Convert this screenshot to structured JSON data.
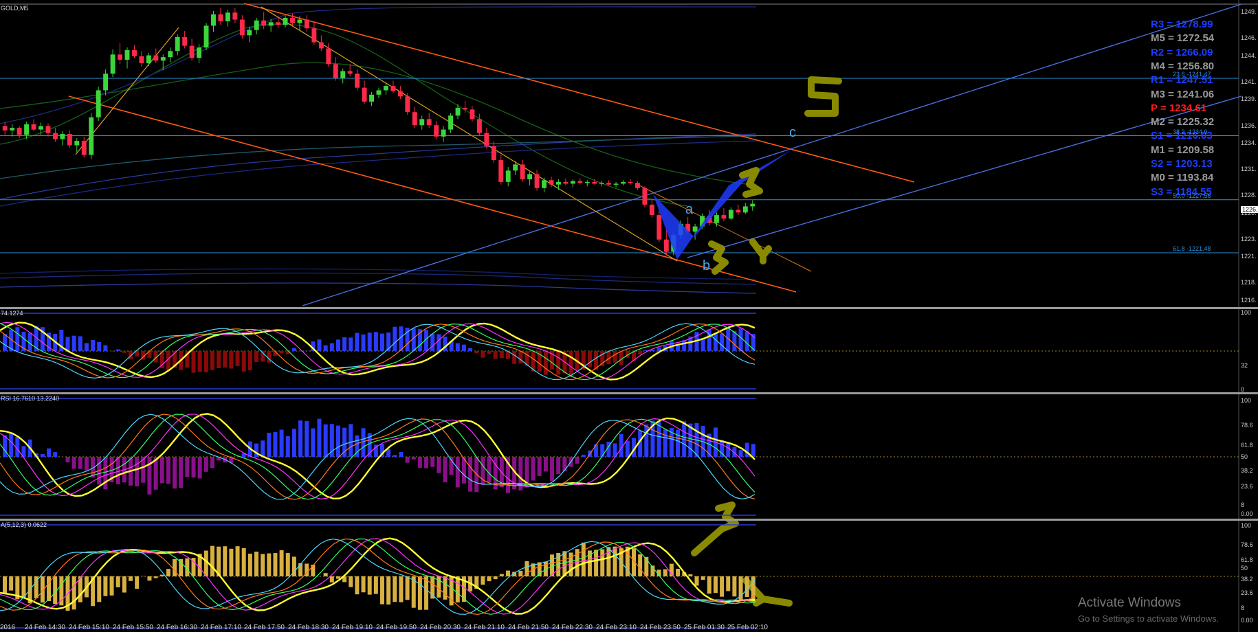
{
  "chart_data": [
    {
      "type": "candlestick",
      "title": "GOLD,M5",
      "y_ticks": [
        "1249.",
        "1246.",
        "1244.",
        "1241.",
        "1239.",
        "1236.",
        "1234.",
        "1231.",
        "1228.",
        "1226.",
        "1223.",
        "1221.",
        "1218.",
        "1216."
      ],
      "ylim": [
        1215.5,
        1249.5
      ],
      "current_price": "1226.",
      "ohlc": [
        [
          1236.0,
          1236.5,
          1235.0,
          1235.5
        ],
        [
          1235.5,
          1236.2,
          1234.8,
          1235.8
        ],
        [
          1235.8,
          1236.0,
          1234.6,
          1235.0
        ],
        [
          1235.0,
          1236.5,
          1234.5,
          1236.2
        ],
        [
          1236.2,
          1236.8,
          1235.4,
          1235.6
        ],
        [
          1235.6,
          1236.4,
          1235.0,
          1236.0
        ],
        [
          1236.0,
          1236.3,
          1234.8,
          1235.2
        ],
        [
          1235.2,
          1235.8,
          1234.2,
          1234.5
        ],
        [
          1234.5,
          1235.4,
          1233.8,
          1235.1
        ],
        [
          1235.1,
          1235.5,
          1233.5,
          1233.8
        ],
        [
          1233.8,
          1234.6,
          1233.0,
          1234.3
        ],
        [
          1234.3,
          1234.8,
          1232.4,
          1232.7
        ],
        [
          1232.7,
          1237.5,
          1232.2,
          1237.0
        ],
        [
          1237.0,
          1240.5,
          1236.6,
          1240.1
        ],
        [
          1240.1,
          1242.5,
          1239.5,
          1242.0
        ],
        [
          1242.0,
          1244.8,
          1241.6,
          1244.2
        ],
        [
          1244.2,
          1245.5,
          1243.1,
          1243.6
        ],
        [
          1243.6,
          1245.0,
          1242.6,
          1244.7
        ],
        [
          1244.7,
          1245.3,
          1243.8,
          1244.0
        ],
        [
          1244.0,
          1244.6,
          1242.8,
          1243.2
        ],
        [
          1243.2,
          1244.4,
          1242.9,
          1244.1
        ],
        [
          1244.1,
          1244.9,
          1243.2,
          1243.5
        ],
        [
          1243.5,
          1244.2,
          1242.4,
          1243.9
        ],
        [
          1243.9,
          1245.0,
          1243.3,
          1244.6
        ],
        [
          1244.6,
          1246.5,
          1244.1,
          1246.2
        ],
        [
          1246.2,
          1246.9,
          1244.9,
          1245.2
        ],
        [
          1245.2,
          1246.0,
          1243.5,
          1243.8
        ],
        [
          1243.8,
          1245.4,
          1243.2,
          1245.0
        ],
        [
          1245.0,
          1247.8,
          1244.7,
          1247.5
        ],
        [
          1247.5,
          1249.2,
          1246.8,
          1248.8
        ],
        [
          1248.8,
          1249.5,
          1247.6,
          1248.0
        ],
        [
          1248.0,
          1249.3,
          1247.4,
          1249.0
        ],
        [
          1249.0,
          1249.5,
          1247.8,
          1248.2
        ],
        [
          1248.2,
          1248.7,
          1246.0,
          1246.4
        ],
        [
          1246.4,
          1247.4,
          1245.6,
          1247.0
        ],
        [
          1247.0,
          1248.4,
          1246.5,
          1248.1
        ],
        [
          1248.1,
          1249.1,
          1247.1,
          1247.5
        ],
        [
          1247.5,
          1248.3,
          1246.8,
          1247.9
        ],
        [
          1247.9,
          1248.5,
          1247.2,
          1247.6
        ],
        [
          1247.6,
          1248.7,
          1247.3,
          1248.4
        ],
        [
          1248.4,
          1248.9,
          1247.5,
          1247.8
        ],
        [
          1247.8,
          1248.6,
          1247.0,
          1248.2
        ],
        [
          1248.2,
          1248.7,
          1246.8,
          1247.2
        ],
        [
          1247.2,
          1247.9,
          1245.3,
          1245.6
        ],
        [
          1245.6,
          1246.4,
          1244.6,
          1244.9
        ],
        [
          1244.9,
          1245.5,
          1242.8,
          1243.1
        ],
        [
          1243.1,
          1243.9,
          1241.2,
          1241.5
        ],
        [
          1241.5,
          1242.6,
          1240.9,
          1242.3
        ],
        [
          1242.3,
          1243.1,
          1241.7,
          1242.0
        ],
        [
          1242.0,
          1242.5,
          1240.1,
          1240.4
        ],
        [
          1240.4,
          1241.2,
          1238.5,
          1238.8
        ],
        [
          1238.8,
          1239.9,
          1238.3,
          1239.6
        ],
        [
          1239.6,
          1240.4,
          1239.2,
          1240.1
        ],
        [
          1240.1,
          1241.0,
          1239.6,
          1240.6
        ],
        [
          1240.6,
          1241.2,
          1239.8,
          1240.0
        ],
        [
          1240.0,
          1240.6,
          1239.1,
          1239.4
        ],
        [
          1239.4,
          1239.8,
          1237.3,
          1237.6
        ],
        [
          1237.6,
          1238.2,
          1235.8,
          1236.1
        ],
        [
          1236.1,
          1237.2,
          1235.6,
          1236.8
        ],
        [
          1236.8,
          1237.5,
          1235.8,
          1236.1
        ],
        [
          1236.1,
          1236.6,
          1234.5,
          1234.8
        ],
        [
          1234.8,
          1236.0,
          1234.2,
          1235.6
        ],
        [
          1235.6,
          1237.5,
          1235.2,
          1237.2
        ],
        [
          1237.2,
          1238.5,
          1236.8,
          1238.1
        ],
        [
          1238.1,
          1238.9,
          1237.5,
          1237.9
        ],
        [
          1237.9,
          1238.3,
          1236.5,
          1236.8
        ],
        [
          1236.8,
          1237.4,
          1234.9,
          1235.2
        ],
        [
          1235.2,
          1235.8,
          1233.4,
          1233.7
        ],
        [
          1233.7,
          1234.3,
          1231.8,
          1232.1
        ],
        [
          1232.1,
          1232.7,
          1229.3,
          1229.6
        ],
        [
          1229.6,
          1231.3,
          1229.1,
          1230.9
        ],
        [
          1230.9,
          1232.0,
          1230.4,
          1231.6
        ],
        [
          1231.6,
          1232.1,
          1229.6,
          1229.9
        ],
        [
          1229.9,
          1230.8,
          1229.2,
          1230.5
        ],
        [
          1230.5,
          1231.0,
          1228.6,
          1228.9
        ],
        [
          1228.9,
          1230.1,
          1228.4,
          1229.8
        ],
        [
          1229.8,
          1230.2,
          1229.0,
          1229.3
        ],
        [
          1229.3,
          1229.9,
          1228.7,
          1229.6
        ],
        [
          1229.6,
          1230.0,
          1229.2,
          1229.4
        ],
        [
          1229.4,
          1229.9,
          1229.0,
          1229.7
        ],
        [
          1229.7,
          1230.0,
          1229.3,
          1229.5
        ],
        [
          1229.5,
          1229.8,
          1229.1,
          1229.6
        ],
        [
          1229.6,
          1229.9,
          1229.3,
          1229.4
        ],
        [
          1229.4,
          1229.7,
          1229.1,
          1229.5
        ],
        [
          1229.5,
          1229.8,
          1229.2,
          1229.3
        ],
        [
          1229.3,
          1229.6,
          1229.0,
          1229.4
        ],
        [
          1229.4,
          1229.8,
          1229.2,
          1229.6
        ],
        [
          1229.6,
          1229.9,
          1229.3,
          1229.5
        ],
        [
          1229.5,
          1229.7,
          1228.7,
          1228.9
        ],
        [
          1228.9,
          1229.1,
          1226.7,
          1227.0
        ],
        [
          1227.0,
          1227.6,
          1225.5,
          1225.8
        ],
        [
          1225.8,
          1226.3,
          1222.7,
          1223.0
        ],
        [
          1223.0,
          1224.2,
          1221.2,
          1221.6
        ],
        [
          1221.6,
          1223.8,
          1221.2,
          1223.5
        ],
        [
          1223.5,
          1225.2,
          1223.1,
          1224.8
        ],
        [
          1224.8,
          1225.6,
          1223.6,
          1223.9
        ],
        [
          1223.9,
          1224.8,
          1223.0,
          1224.5
        ],
        [
          1224.5,
          1226.0,
          1224.2,
          1225.7
        ],
        [
          1225.7,
          1226.4,
          1224.6,
          1224.9
        ],
        [
          1224.9,
          1226.1,
          1224.5,
          1225.8
        ],
        [
          1225.8,
          1226.6,
          1225.1,
          1225.4
        ],
        [
          1225.4,
          1226.7,
          1225.2,
          1226.4
        ],
        [
          1226.4,
          1227.0,
          1225.8,
          1226.1
        ],
        [
          1226.1,
          1227.2,
          1225.9,
          1226.8
        ],
        [
          1226.8,
          1227.5,
          1226.3,
          1227.1
        ]
      ],
      "horizontal_levels": [
        {
          "label": "23.6 -1241.47",
          "value": 1241.47
        },
        {
          "label": "38.2 -1234.9",
          "value": 1234.9
        },
        {
          "label": "50.0 -1227.56",
          "value": 1227.56
        },
        {
          "label": "61.8 -1221.48",
          "value": 1221.48
        }
      ],
      "pivots": [
        {
          "label": "R3 = 1278.99",
          "color": "#1c3cff"
        },
        {
          "label": "M5 = 1272.54",
          "color": "#9a9a9a"
        },
        {
          "label": "R2 = 1266.09",
          "color": "#1c3cff"
        },
        {
          "label": "M4 = 1256.80",
          "color": "#9a9a9a"
        },
        {
          "label": "R1 = 1247.51",
          "color": "#1c3cff"
        },
        {
          "label": "M3 = 1241.06",
          "color": "#9a9a9a"
        },
        {
          "label": "P  = 1234.61",
          "color": "#ff1a1a"
        },
        {
          "label": "M2 = 1225.32",
          "color": "#9a9a9a"
        },
        {
          "label": "S1 = 1216.03",
          "color": "#1c3cff"
        },
        {
          "label": "M1 = 1209.58",
          "color": "#9a9a9a"
        },
        {
          "label": "S2 = 1203.13",
          "color": "#1c3cff"
        },
        {
          "label": "M0 = 1193.84",
          "color": "#9a9a9a"
        },
        {
          "label": "S3 = 1184.55",
          "color": "#1c3cff"
        }
      ],
      "pattern_labels": [
        "a",
        "b",
        "c"
      ],
      "annotations": [
        "5",
        "3",
        "3",
        "4"
      ]
    },
    {
      "type": "oscillator",
      "title": "74.1274",
      "y_ticks": [
        "100",
        "32",
        "0"
      ]
    },
    {
      "type": "oscillator",
      "title": "RSI 16.7610 13.2240",
      "y_ticks": [
        "100",
        "78.6",
        "61.8",
        "50",
        "38.2",
        "23.6",
        "8",
        "0.00"
      ]
    },
    {
      "type": "oscillator",
      "title": "A(5,12,3) 0.0622",
      "y_ticks": [
        "100",
        "78.6",
        "61.8",
        "50",
        "38.2",
        "23.6",
        "8",
        "0.00"
      ],
      "annotations": [
        "3",
        "4"
      ]
    }
  ],
  "x_axis": [
    "2016",
    "24 Feb 14:30",
    "24 Feb 15:10",
    "24 Feb 15:50",
    "24 Feb 16:30",
    "24 Feb 17:10",
    "24 Feb 17:50",
    "24 Feb 18:30",
    "24 Feb 19:10",
    "24 Feb 19:50",
    "24 Feb 20:30",
    "24 Feb 21:10",
    "24 Feb 21:50",
    "24 Feb 22:30",
    "24 Feb 23:10",
    "24 Feb 23:50",
    "25 Feb 01:30",
    "25 Feb 02:10"
  ],
  "watermark": {
    "line1": "Activate Windows",
    "line2": "Go to Settings to activate Windows."
  },
  "colors": {
    "bull": "#3cd63c",
    "bear": "#ff2a4a",
    "fib": "#2a8fd6",
    "channel": "#ff5a14",
    "trend": "#3a6ad6",
    "pattern": "#1e3cff",
    "annot": "#8a8a00"
  }
}
